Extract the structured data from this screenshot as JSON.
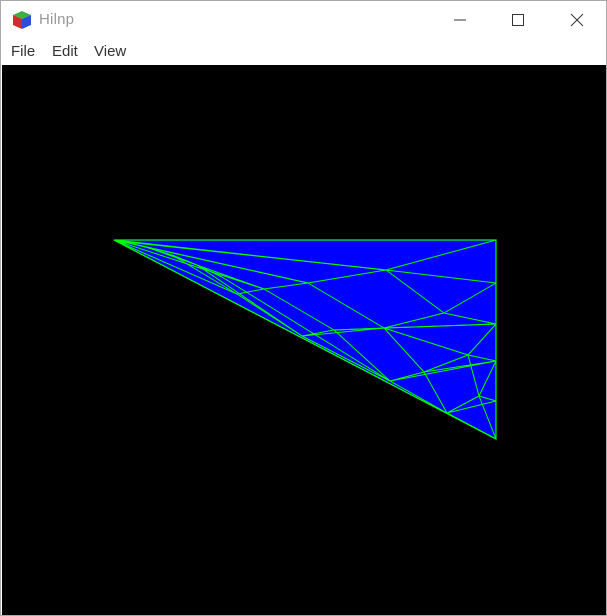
{
  "window": {
    "title": "Hilnp",
    "app_icon": "cube-icon",
    "controls": {
      "minimize_icon": "minimize-icon",
      "maximize_icon": "maximize-icon",
      "close_icon": "close-icon"
    }
  },
  "menubar": {
    "items": [
      {
        "label": "File"
      },
      {
        "label": "Edit"
      },
      {
        "label": "View"
      }
    ]
  },
  "canvas": {
    "background": "#000000",
    "fill_color": "#0000ff",
    "edge_color": "#00ff00"
  }
}
